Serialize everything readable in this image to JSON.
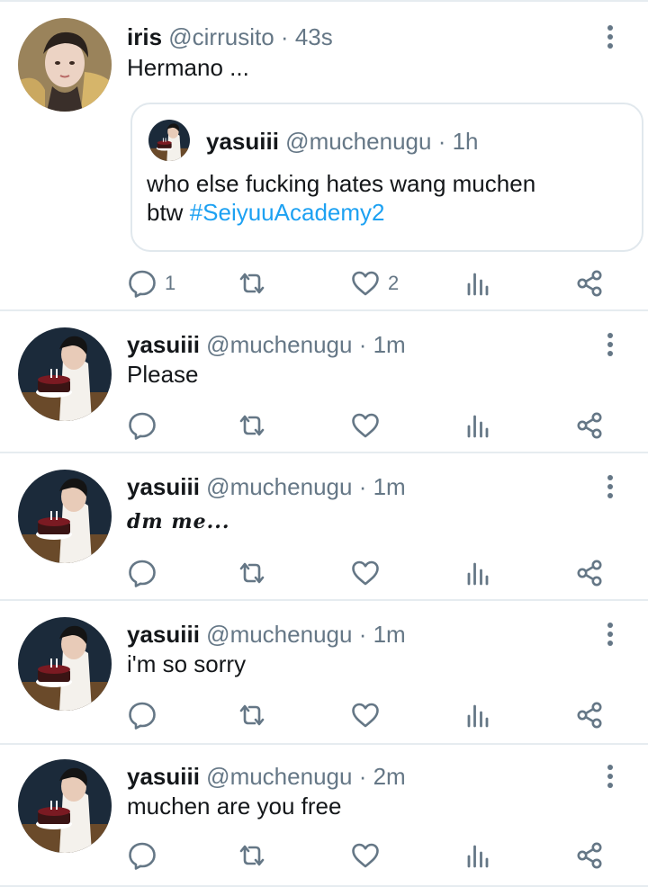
{
  "colors": {
    "text": "#14171a",
    "secondary": "#657786",
    "link": "#1da1f2",
    "divider": "#e6ecf0"
  },
  "icons": {
    "reply": "reply-icon",
    "retweet": "retweet-icon",
    "like": "heart-icon",
    "views": "views-icon",
    "share": "share-icon",
    "more": "more-vertical-icon"
  },
  "tweets": [
    {
      "name": "iris",
      "handle": "@cirrusito",
      "time": "43s",
      "text": "Hermano ...",
      "replies": "1",
      "retweets": "",
      "likes": "2",
      "quote": {
        "name": "yasuiii",
        "handle": "@muchenugu",
        "time": "1h",
        "line1": "who else fucking hates wang muchen",
        "line2_prefix": "btw ",
        "hashtag": "#SeiyuuAcademy2"
      }
    },
    {
      "name": "yasuiii",
      "handle": "@muchenugu",
      "time": "1m",
      "text": "Please",
      "replies": "",
      "retweets": "",
      "likes": ""
    },
    {
      "name": "yasuiii",
      "handle": "@muchenugu",
      "time": "1m",
      "text": "𝒅𝒎 𝒎𝒆...",
      "replies": "",
      "retweets": "",
      "likes": ""
    },
    {
      "name": "yasuiii",
      "handle": "@muchenugu",
      "time": "1m",
      "text": "i'm so sorry",
      "replies": "",
      "retweets": "",
      "likes": ""
    },
    {
      "name": "yasuiii",
      "handle": "@muchenugu",
      "time": "2m",
      "text": "muchen are you free",
      "replies": "",
      "retweets": "",
      "likes": ""
    }
  ]
}
